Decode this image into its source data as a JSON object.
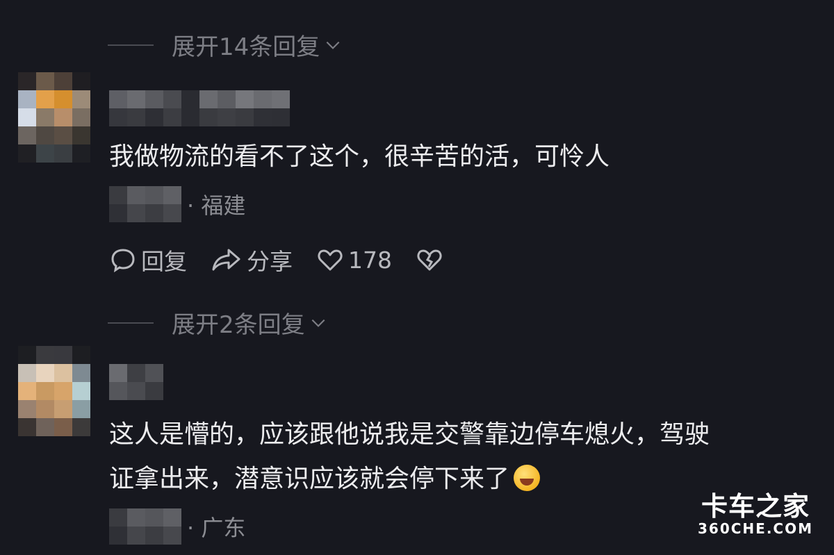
{
  "thread1": {
    "expand_label": "展开14条回复"
  },
  "comment1": {
    "text": "我做物流的看不了这个，很辛苦的活，可怜人",
    "location": "· 福建",
    "reply_label": "回复",
    "share_label": "分享",
    "like_count": "178"
  },
  "thread2": {
    "expand_label": "展开2条回复"
  },
  "comment2": {
    "text_line1": "这人是懵的，应该跟他说我是交警靠边停车熄火，驾驶",
    "text_line2": "证拿出来，潜意识应该就会停下来了",
    "emoji": "rolling-on-floor-laughing-emoji",
    "location": "· 广东"
  },
  "watermark": {
    "cn": "卡车之家",
    "en": "360CHE.COM"
  },
  "colors": {
    "background": "#17181f",
    "text": "#ececee",
    "muted": "#7d7e85"
  }
}
